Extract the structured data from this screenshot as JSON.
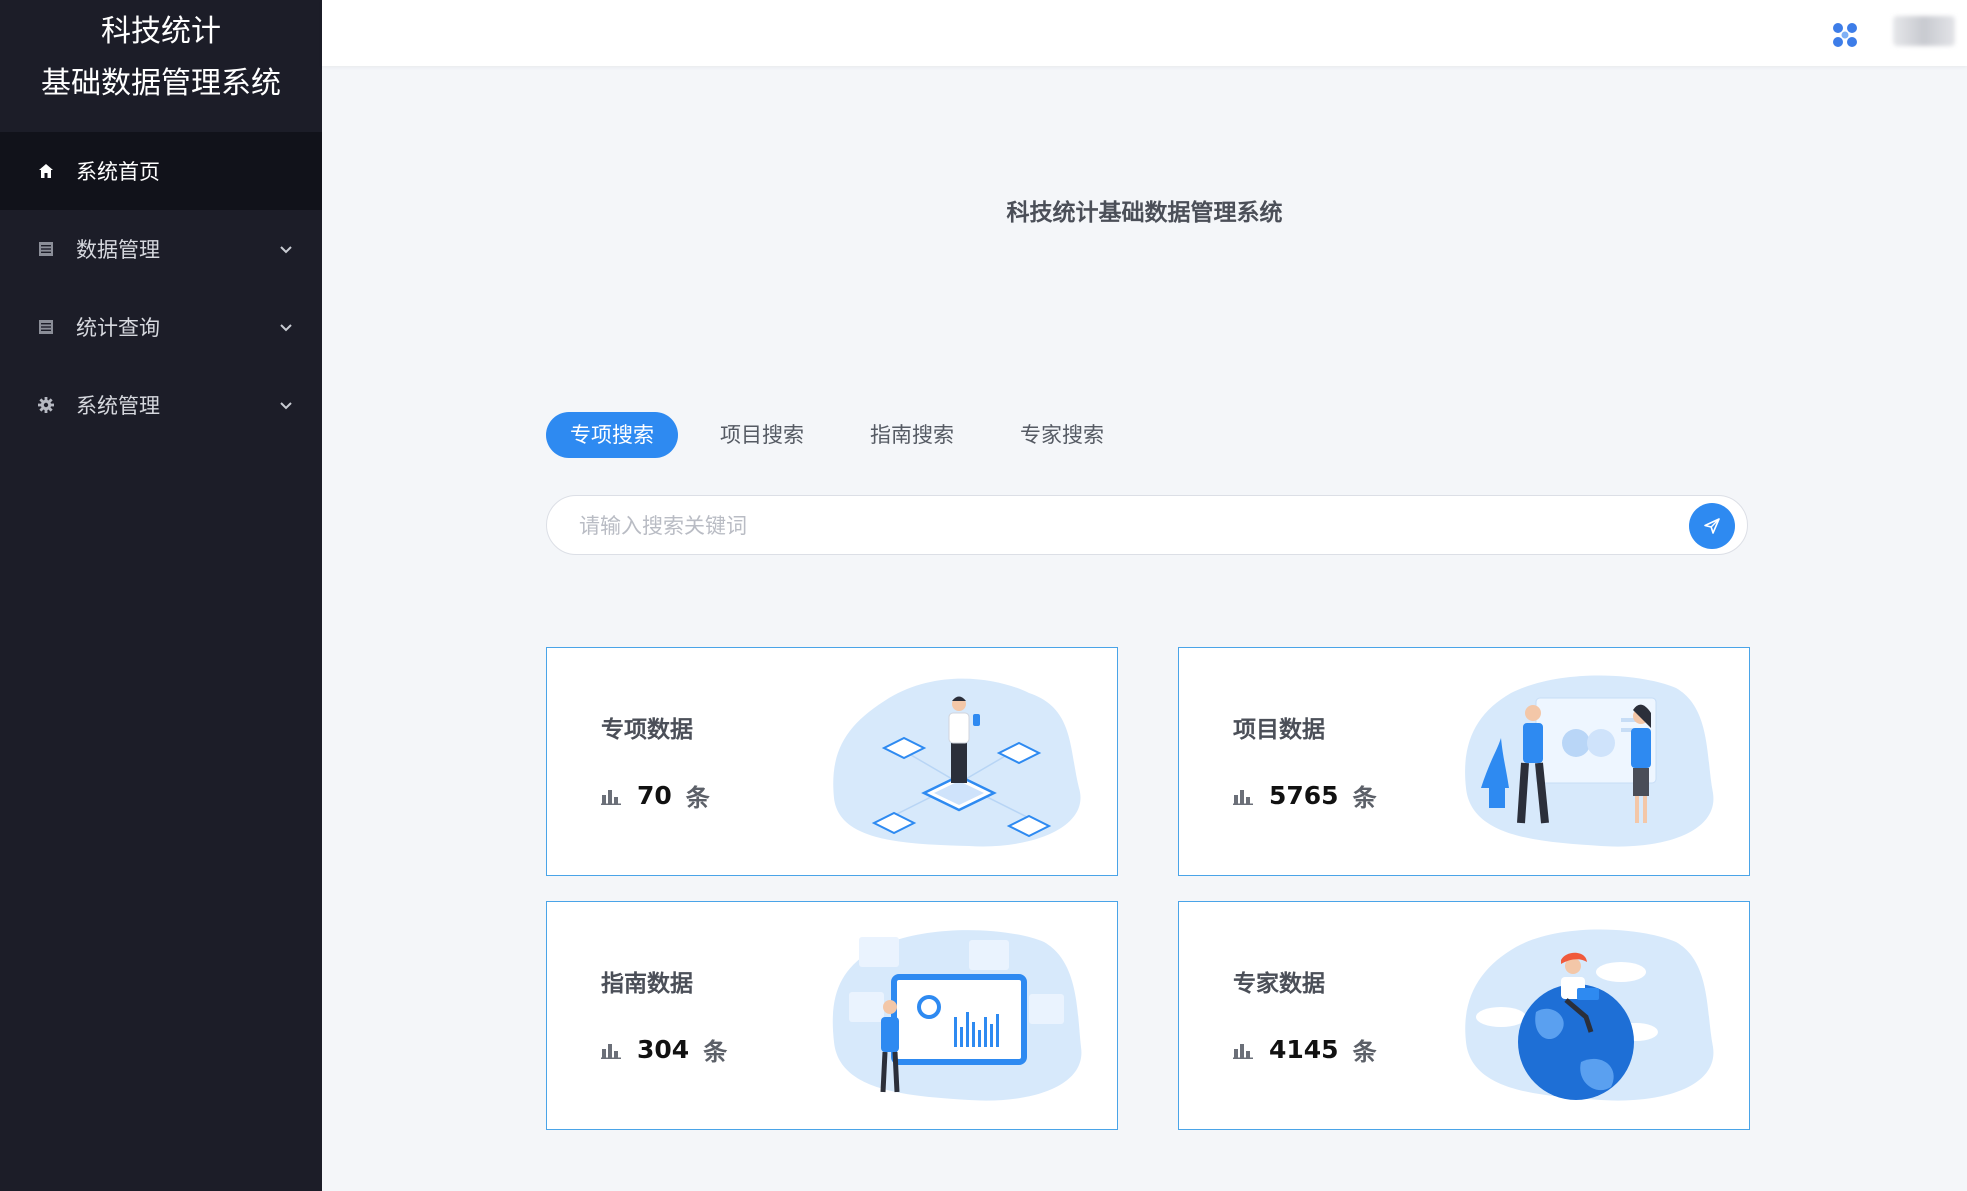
{
  "sidebar": {
    "brand_line1": "科技统计",
    "brand_line2": "基础数据管理系统",
    "items": [
      {
        "label": "系统首页",
        "icon": "home-icon",
        "active": true
      },
      {
        "label": "数据管理",
        "icon": "list-icon"
      },
      {
        "label": "统计查询",
        "icon": "list-icon"
      },
      {
        "label": "系统管理",
        "icon": "gear-icon"
      }
    ]
  },
  "header": {
    "app_icon": "apps-icon",
    "avatar": "user-avatar"
  },
  "main": {
    "title": "科技统计基础数据管理系统",
    "tabs": [
      {
        "label": "专项搜索",
        "active": true
      },
      {
        "label": "项目搜索"
      },
      {
        "label": "指南搜索"
      },
      {
        "label": "专家搜索"
      }
    ],
    "search": {
      "placeholder": "请输入搜索关键词",
      "value": ""
    },
    "cards": [
      {
        "title": "专项数据",
        "count": "70",
        "unit": "条",
        "illustration": "chip-person-illustration"
      },
      {
        "title": "项目数据",
        "count": "5765",
        "unit": "条",
        "illustration": "meeting-board-illustration"
      },
      {
        "title": "指南数据",
        "count": "304",
        "unit": "条",
        "illustration": "analytics-screen-illustration"
      },
      {
        "title": "专家数据",
        "count": "4145",
        "unit": "条",
        "illustration": "globe-person-illustration"
      }
    ]
  },
  "colors": {
    "sidebar_bg": "#1c1d28",
    "accent": "#2e8af1",
    "card_border": "#4aa4e8",
    "page_bg": "#f4f6f9"
  }
}
